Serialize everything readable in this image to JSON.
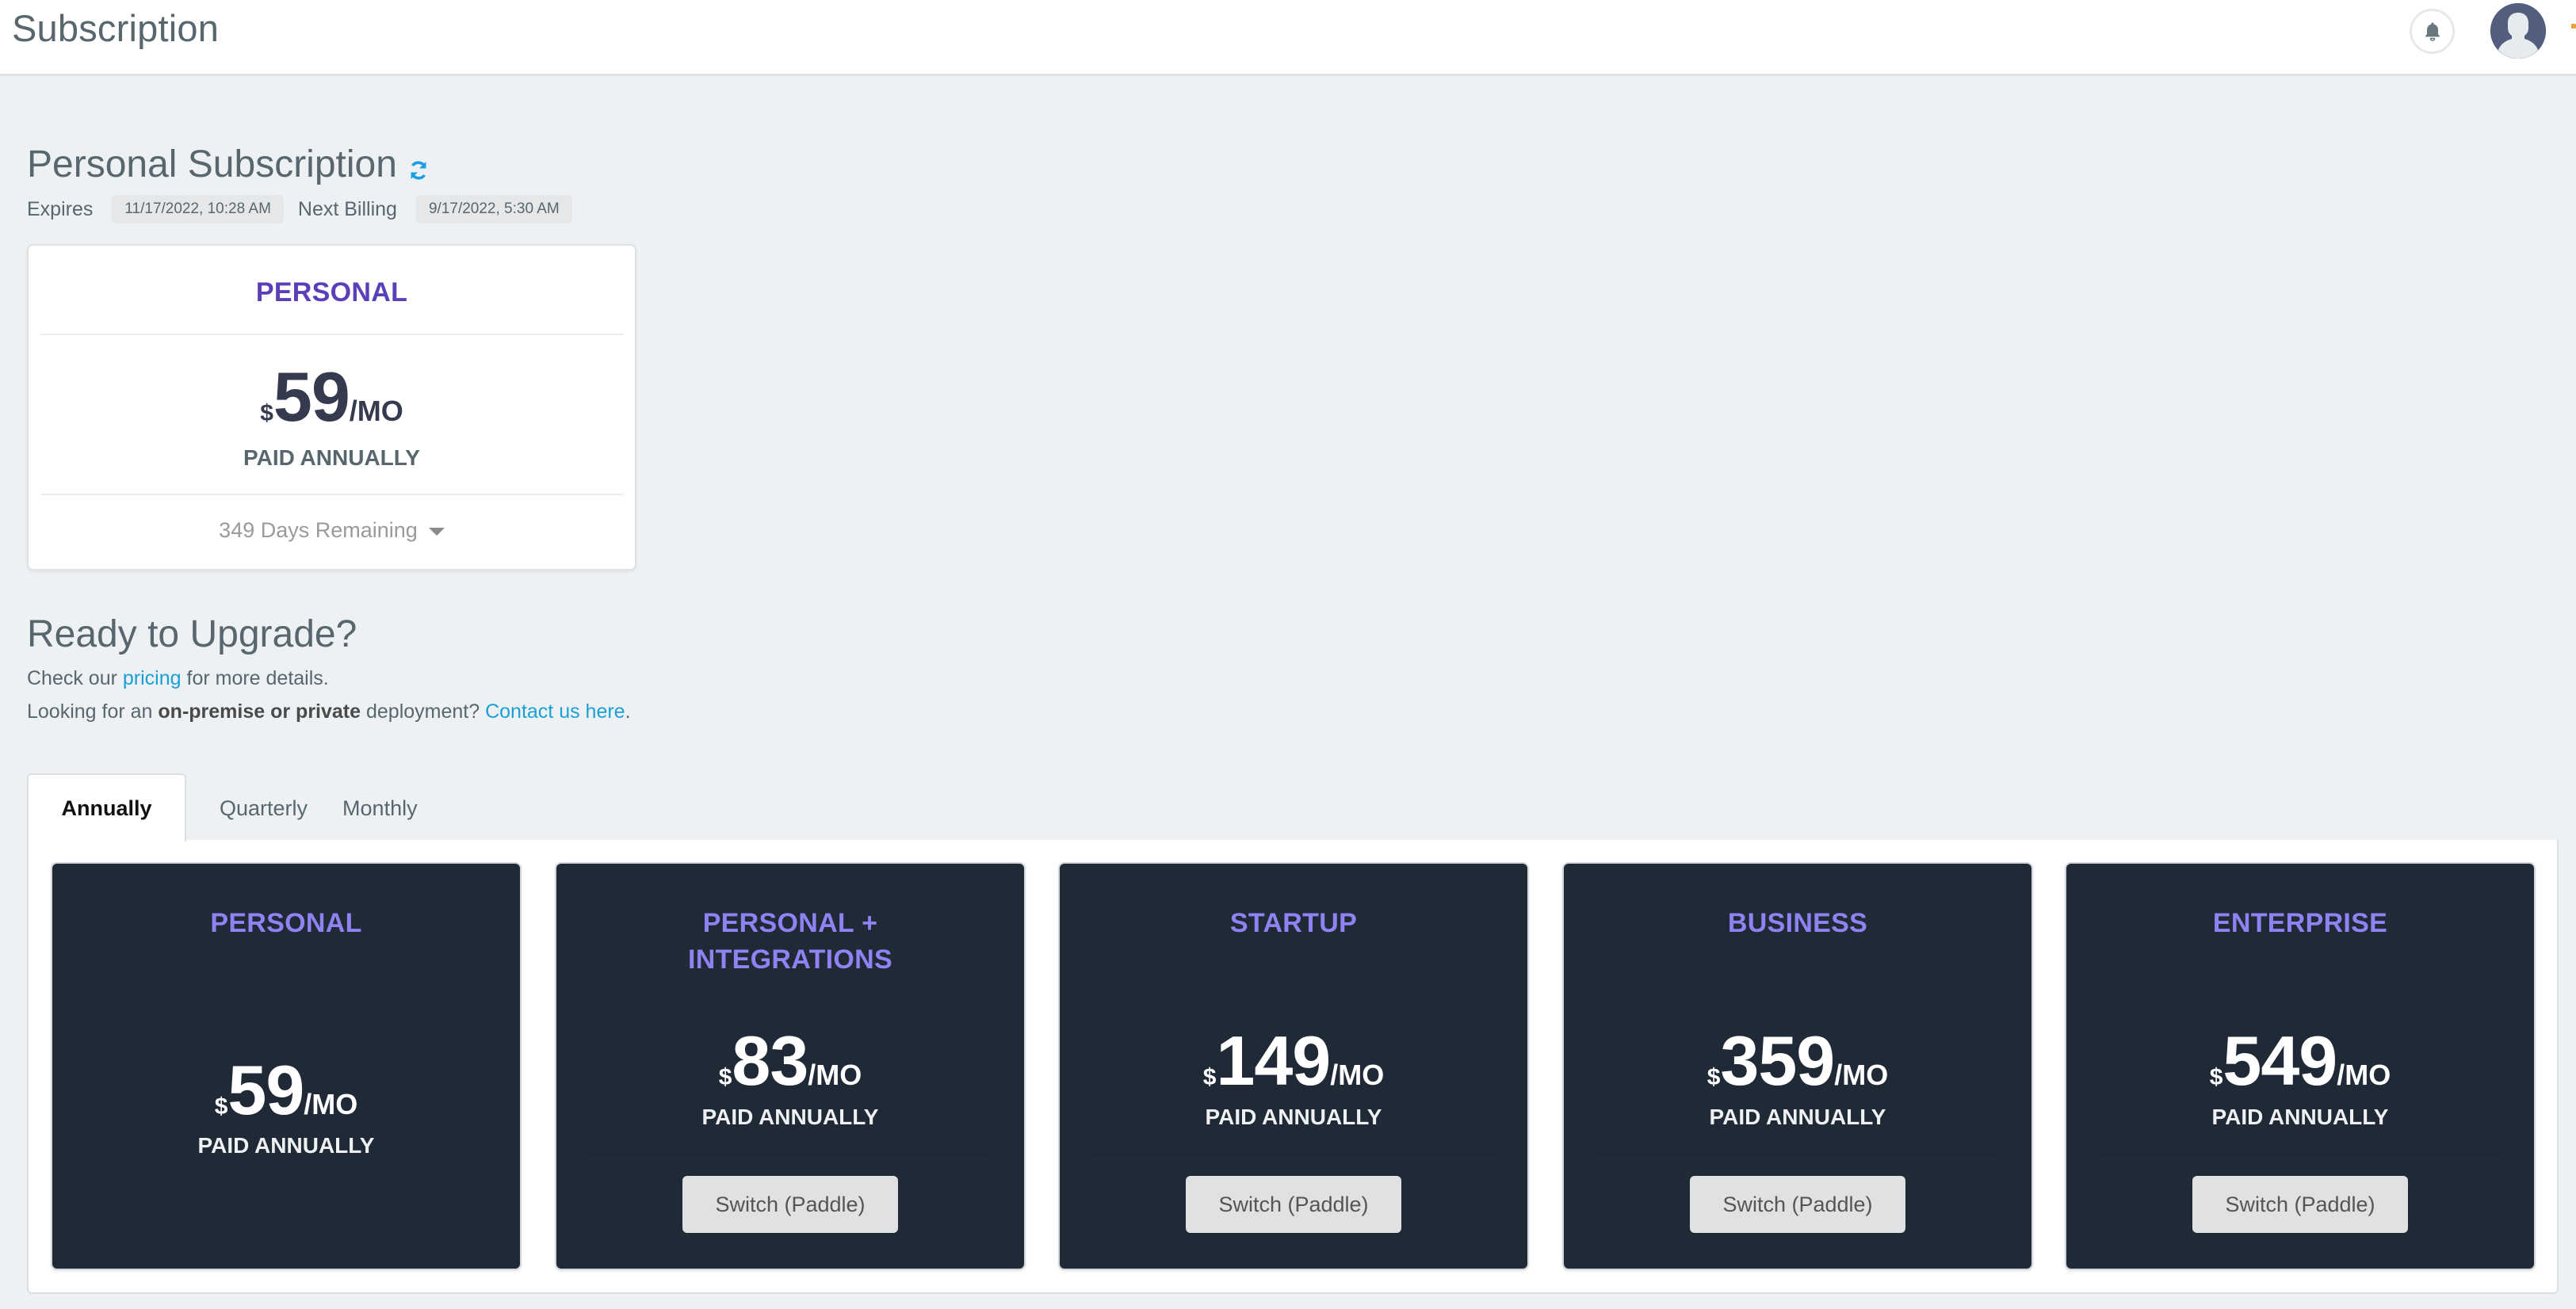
{
  "header": {
    "title": "Subscription",
    "icons": {
      "notifications": "bell-icon",
      "avatar": "user-avatar-icon"
    }
  },
  "subscription": {
    "title": "Personal Subscription",
    "refresh_icon": "refresh-icon",
    "expires_label": "Expires",
    "expires_value": "11/17/2022, 10:28 AM",
    "next_billing_label": "Next Billing",
    "next_billing_value": "9/17/2022, 5:30 AM",
    "current_plan": {
      "name": "PERSONAL",
      "currency": "$",
      "amount": "59",
      "per": "/MO",
      "period": "PAID ANNUALLY",
      "days_remaining": "349 Days Remaining"
    }
  },
  "upgrade": {
    "title": "Ready to Upgrade?",
    "line1_prefix": "Check our ",
    "line1_link": "pricing",
    "line1_suffix": " for more details.",
    "line2_prefix": "Looking for an ",
    "line2_bold": "on-premise or private",
    "line2_middle": " deployment? ",
    "line2_link": "Contact us here",
    "line2_suffix": "."
  },
  "tabs": [
    {
      "label": "Annually",
      "active": true
    },
    {
      "label": "Quarterly",
      "active": false
    },
    {
      "label": "Monthly",
      "active": false
    }
  ],
  "plans": [
    {
      "name": "PERSONAL",
      "currency": "$",
      "amount": "59",
      "per": "/MO",
      "period": "PAID ANNUALLY",
      "button": null
    },
    {
      "name": "PERSONAL + INTEGRATIONS",
      "currency": "$",
      "amount": "83",
      "per": "/MO",
      "period": "PAID ANNUALLY",
      "button": "Switch (Paddle)"
    },
    {
      "name": "STARTUP",
      "currency": "$",
      "amount": "149",
      "per": "/MO",
      "period": "PAID ANNUALLY",
      "button": "Switch (Paddle)"
    },
    {
      "name": "BUSINESS",
      "currency": "$",
      "amount": "359",
      "per": "/MO",
      "period": "PAID ANNUALLY",
      "button": "Switch (Paddle)"
    },
    {
      "name": "ENTERPRISE",
      "currency": "$",
      "amount": "549",
      "per": "/MO",
      "period": "PAID ANNUALLY",
      "button": "Switch (Paddle)"
    }
  ],
  "colors": {
    "accent_link": "#1a9fd6",
    "plan_title_light": "#5a3fb8",
    "plan_title_dark": "#8f83f3",
    "card_dark_bg": "#1f2a36",
    "page_bg": "#eef1f3"
  }
}
